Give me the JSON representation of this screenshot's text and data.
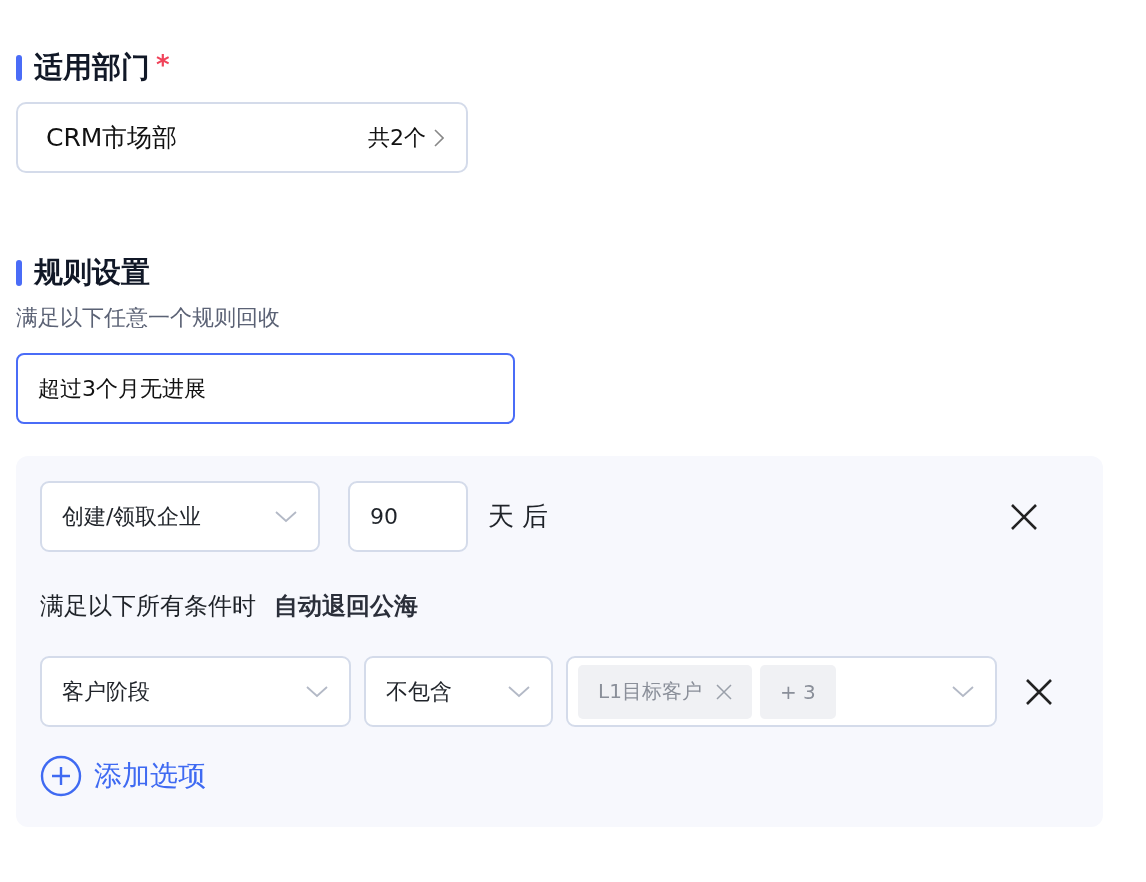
{
  "department_section": {
    "title": "适用部门",
    "required_mark": "*",
    "selector": {
      "value": "CRM市场部",
      "count": "共2个"
    }
  },
  "rules_section": {
    "title": "规则设置",
    "description": "满足以下任意一个规则回收",
    "rule_name": {
      "value": "超过3个月无进展"
    },
    "rule": {
      "trigger": {
        "value": "创建/领取企业"
      },
      "days": {
        "value": "90"
      },
      "unit": "天 后",
      "condition_intro": "满足以下所有条件时",
      "action": "自动退回公海",
      "conditions": [
        {
          "field": {
            "value": "客户阶段"
          },
          "operator": {
            "value": "不包含"
          },
          "tags": [
            {
              "label": "L1目标客户",
              "kind": "removable"
            },
            {
              "label": "+ 3",
              "kind": "more"
            }
          ]
        }
      ],
      "add_option": "添加选项"
    }
  }
}
